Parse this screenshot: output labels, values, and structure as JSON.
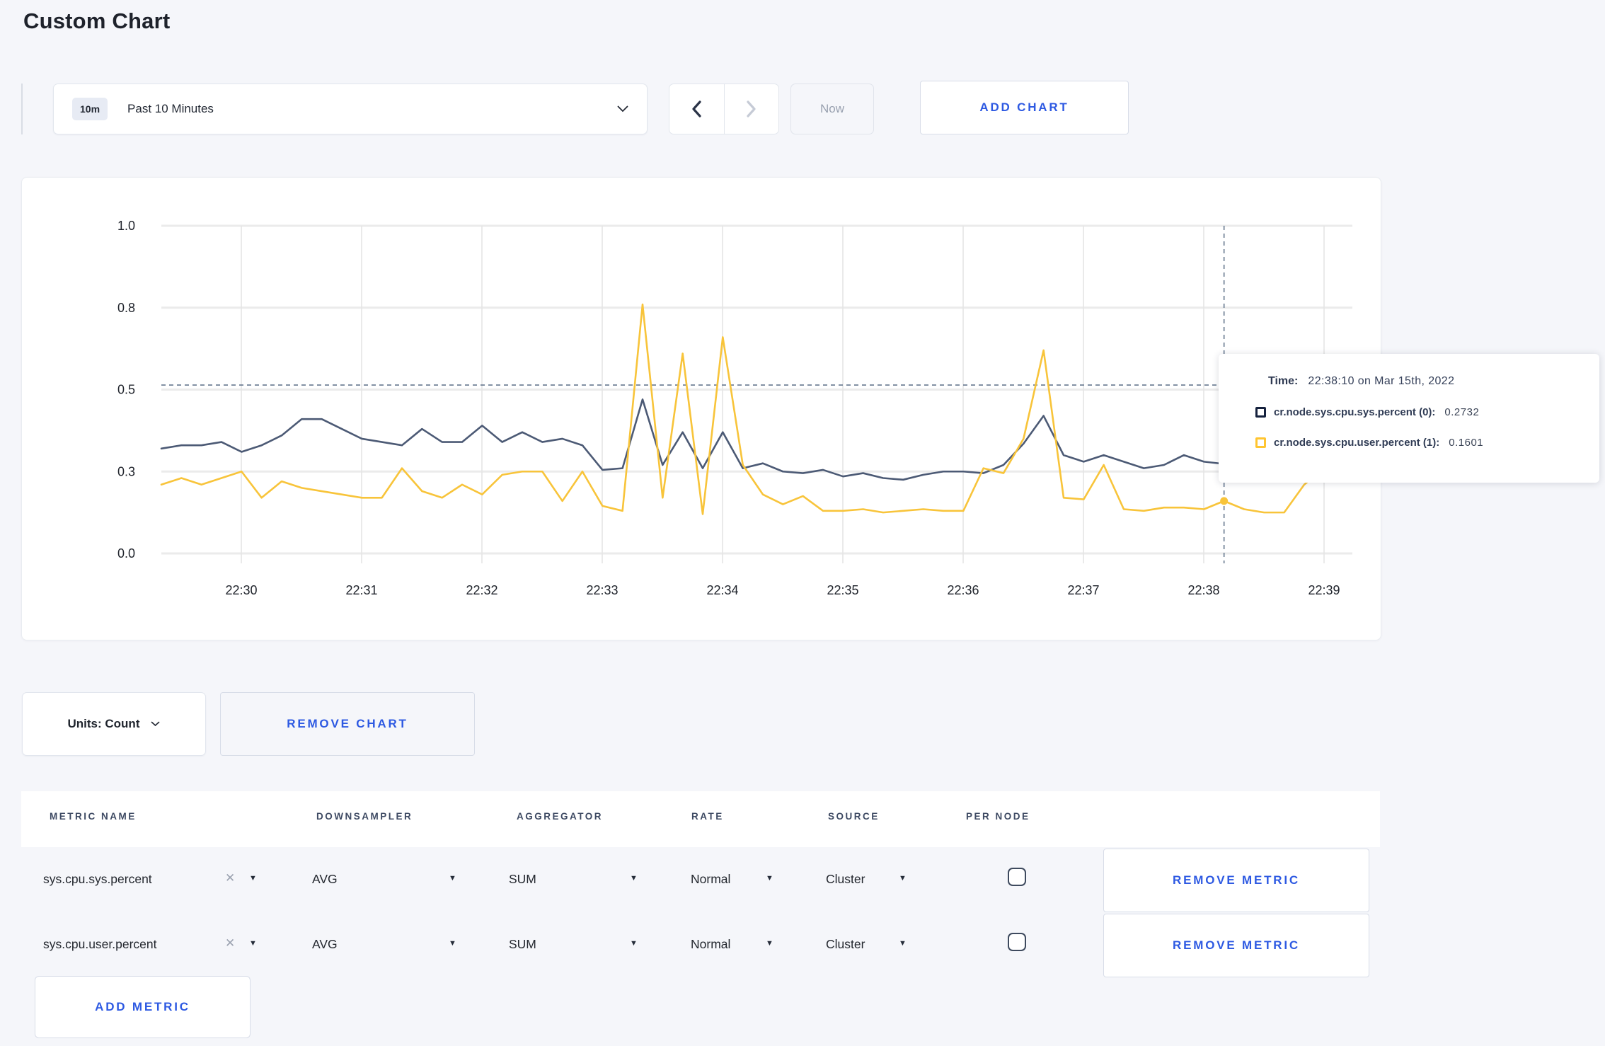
{
  "page": {
    "title": "Custom Chart",
    "background": "#F5F6FA",
    "accent_blue": "#2D59E2"
  },
  "toolbar": {
    "time_window_badge": "10m",
    "time_window_label": "Past 10 Minutes",
    "now_label": "Now",
    "add_chart_label": "ADD CHART"
  },
  "chart_data": {
    "type": "line",
    "title": "",
    "xlabel": "",
    "ylabel": "",
    "ylim": [
      0,
      1
    ],
    "grid": true,
    "legend_position": "none",
    "x": [
      "22:29:20",
      "22:29:30",
      "22:29:40",
      "22:29:50",
      "22:30:00",
      "22:30:10",
      "22:30:20",
      "22:30:30",
      "22:30:40",
      "22:30:50",
      "22:31:00",
      "22:31:10",
      "22:31:20",
      "22:31:30",
      "22:31:40",
      "22:31:50",
      "22:32:00",
      "22:32:10",
      "22:32:20",
      "22:32:30",
      "22:32:40",
      "22:32:50",
      "22:33:00",
      "22:33:10",
      "22:33:20",
      "22:33:30",
      "22:33:40",
      "22:33:50",
      "22:34:00",
      "22:34:10",
      "22:34:20",
      "22:34:30",
      "22:34:40",
      "22:34:50",
      "22:35:00",
      "22:35:10",
      "22:35:20",
      "22:35:30",
      "22:35:40",
      "22:35:50",
      "22:36:00",
      "22:36:10",
      "22:36:20",
      "22:36:30",
      "22:36:40",
      "22:36:50",
      "22:37:00",
      "22:37:10",
      "22:37:20",
      "22:37:30",
      "22:37:40",
      "22:37:50",
      "22:38:00",
      "22:38:10",
      "22:38:20",
      "22:38:30",
      "22:38:40",
      "22:38:50",
      "22:39:00",
      "22:39:10"
    ],
    "series": [
      {
        "name": "cr.node.sys.cpu.sys.percent",
        "color": "#4C5A75",
        "values": [
          0.32,
          0.33,
          0.33,
          0.34,
          0.31,
          0.33,
          0.36,
          0.41,
          0.41,
          0.38,
          0.35,
          0.34,
          0.33,
          0.38,
          0.34,
          0.34,
          0.39,
          0.34,
          0.37,
          0.34,
          0.35,
          0.33,
          0.255,
          0.26,
          0.47,
          0.27,
          0.37,
          0.26,
          0.37,
          0.26,
          0.275,
          0.25,
          0.245,
          0.255,
          0.235,
          0.245,
          0.23,
          0.225,
          0.24,
          0.25,
          0.25,
          0.245,
          0.27,
          0.335,
          0.42,
          0.3,
          0.28,
          0.3,
          0.28,
          0.26,
          0.27,
          0.3,
          0.28,
          0.2732,
          0.29,
          0.31,
          0.28,
          0.29,
          0.3,
          0.295
        ]
      },
      {
        "name": "cr.node.sys.cpu.user.percent",
        "color": "#F8C43A",
        "values": [
          0.21,
          0.23,
          0.21,
          0.23,
          0.25,
          0.17,
          0.22,
          0.2,
          0.19,
          0.18,
          0.17,
          0.17,
          0.26,
          0.19,
          0.17,
          0.21,
          0.18,
          0.24,
          0.25,
          0.25,
          0.16,
          0.25,
          0.145,
          0.13,
          0.76,
          0.17,
          0.61,
          0.12,
          0.66,
          0.27,
          0.18,
          0.15,
          0.175,
          0.13,
          0.13,
          0.135,
          0.125,
          0.13,
          0.135,
          0.13,
          0.13,
          0.26,
          0.245,
          0.35,
          0.62,
          0.17,
          0.165,
          0.27,
          0.135,
          0.13,
          0.14,
          0.14,
          0.135,
          0.1601,
          0.135,
          0.125,
          0.125,
          0.21,
          0.26,
          0.22
        ]
      }
    ],
    "y_ticks": [
      {
        "value": 0,
        "label": "0.0"
      },
      {
        "value": 0.25,
        "label": "0.3"
      },
      {
        "value": 0.5,
        "label": "0.5"
      },
      {
        "value": 0.75,
        "label": "0.8"
      },
      {
        "value": 1,
        "label": "1.0"
      }
    ],
    "x_ticks": [
      "22:30",
      "22:31",
      "22:32",
      "22:33",
      "22:34",
      "22:35",
      "22:36",
      "22:37",
      "22:38",
      "22:39"
    ],
    "crosshair": {
      "time": "22:38:10",
      "time_index": 53,
      "guide_value": 0.514,
      "color": "#66788F"
    }
  },
  "tooltip": {
    "time_label": "Time:",
    "time_value": "22:38:10 on Mar 15th, 2022",
    "rows": [
      {
        "name": "cr.node.sys.cpu.sys.percent (0):",
        "value": "0.2732",
        "swatch_color": "#16223E"
      },
      {
        "name": "cr.node.sys.cpu.user.percent (1):",
        "value": "0.1601",
        "swatch_color": "#FFC531"
      }
    ]
  },
  "chart_controls": {
    "units_label": "Units: Count",
    "remove_chart_label": "REMOVE CHART"
  },
  "table": {
    "headers": [
      "METRIC NAME",
      "DOWNSAMPLER",
      "AGGREGATOR",
      "RATE",
      "SOURCE",
      "PER NODE"
    ],
    "rows": [
      {
        "metric_name": "sys.cpu.sys.percent",
        "downsampler": "AVG",
        "aggregator": "SUM",
        "rate": "Normal",
        "source": "Cluster",
        "per_node_checked": false,
        "remove_label": "REMOVE METRIC"
      },
      {
        "metric_name": "sys.cpu.user.percent",
        "downsampler": "AVG",
        "aggregator": "SUM",
        "rate": "Normal",
        "source": "Cluster",
        "per_node_checked": false,
        "remove_label": "REMOVE METRIC"
      }
    ],
    "add_metric_label": "ADD METRIC"
  }
}
